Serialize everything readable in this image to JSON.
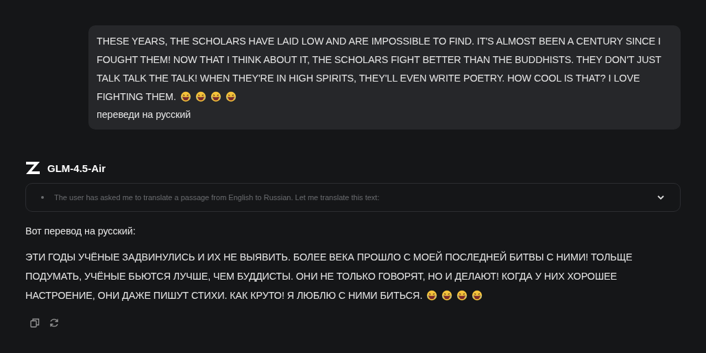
{
  "user_message": {
    "lines": [
      "THESE YEARS, THE SCHOLARS HAVE LAID LOW AND ARE IMPOSSIBLE TO FIND. IT'S ALMOST BEEN A CENTURY SINCE I FOUGHT THEM! NOW THAT I THINK ABOUT IT, THE SCHOLARS FIGHT BETTER THAN THE BUDDHISTS. THEY DON'T JUST TALK TALK THE TALK! WHEN THEY'RE IN HIGH SPIRITS, THEY'LL EVEN WRITE POETRY. HOW COOL IS THAT? I LOVE FIGHTING THEM.",
      "переведи на русский"
    ]
  },
  "assistant": {
    "model": "GLM-4.5-Air",
    "thinking": {
      "text": "The user has asked me to translate a passage from English to Russian. Let me translate this text:",
      "expanded": false
    },
    "paragraphs": [
      "Вот перевод на русский:",
      "ЭТИ ГОДЫ УЧЁНЫЕ ЗАДВИНУЛИСЬ И ИХ НЕ ВЫЯВИТЬ. БОЛЕЕ ВЕКА ПРОШЛО С МОЕЙ ПОСЛЕДНЕЙ БИТВЫ С НИМИ! ТОЛЬЩЕ ПОДУМАТЬ, УЧЁНЫЕ БЬЮТСЯ ЛУЧШЕ, ЧЕМ БУДДИСТЫ. ОНИ НЕ ТОЛЬКО ГОВОРЯТ, НО И ДЕЛАЮТ! КОГДА У НИХ ХОРОШЕЕ НАСТРОЕНИЕ, ОНИ ДАЖЕ ПИШУТ СТИХИ. КАК КРУТО! Я ЛЮБЛЮ С НИМИ БИТЬСЯ."
    ]
  }
}
